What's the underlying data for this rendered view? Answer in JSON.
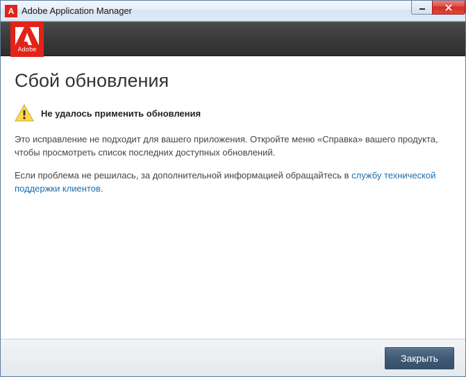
{
  "titlebar": {
    "app_icon_text": "A",
    "title": "Adobe Application Manager"
  },
  "logo": {
    "text": "Adobe"
  },
  "content": {
    "heading": "Сбой обновления",
    "warning_title": "Не удалось применить обновления",
    "paragraph1": "Это исправление не подходит для вашего приложения. Откройте меню «Справка» вашего продукта, чтобы просмотреть список последних доступных обновлений.",
    "paragraph2_prefix": "Если проблема не решилась, за дополнительной информацией обращайтесь в ",
    "link_text": "службу технической поддержки клиентов",
    "paragraph2_suffix": "."
  },
  "footer": {
    "close_label": "Закрыть"
  }
}
